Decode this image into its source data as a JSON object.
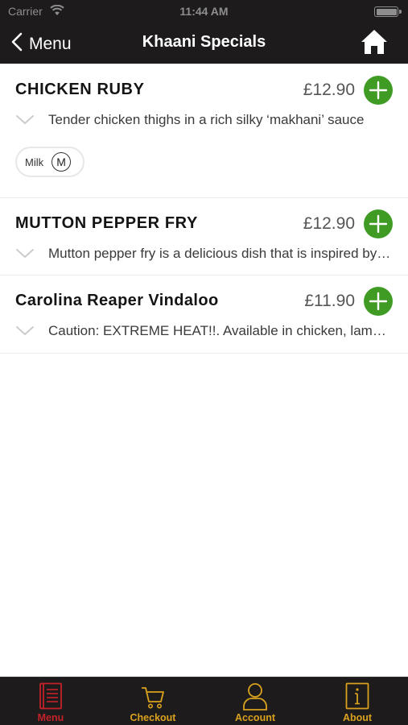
{
  "status_bar": {
    "carrier": "Carrier",
    "time": "11:44 AM"
  },
  "nav": {
    "back_label": "Menu",
    "title": "Khaani Specials"
  },
  "items": [
    {
      "name": "CHICKEN RUBY",
      "price": "£12.90",
      "description": "Tender chicken thighs in a rich silky ‘makhani’ sauce",
      "allergens": [
        {
          "label": "Milk",
          "code": "M"
        }
      ]
    },
    {
      "name": "MUTTON PEPPER FRY",
      "price": "£12.90",
      "description": "Mutton pepper fry is a delicious dish that is inspired by south indian cuisine"
    },
    {
      "name": "Carolina Reaper Vindaloo",
      "price": "£11.90",
      "description": "Caution: EXTREME HEAT!!. Available in chicken, lamb or vegetable"
    }
  ],
  "tabs": [
    {
      "label": "Menu",
      "icon": "menu-book-icon",
      "active": true
    },
    {
      "label": "Checkout",
      "icon": "cart-icon",
      "active": false
    },
    {
      "label": "Account",
      "icon": "person-icon",
      "active": false
    },
    {
      "label": "About",
      "icon": "info-icon",
      "active": false
    }
  ],
  "colors": {
    "bar_background": "#1d1b1b",
    "add_button": "#3f9b24",
    "tab_inactive": "#d9a21e",
    "tab_active": "#c4222a"
  }
}
